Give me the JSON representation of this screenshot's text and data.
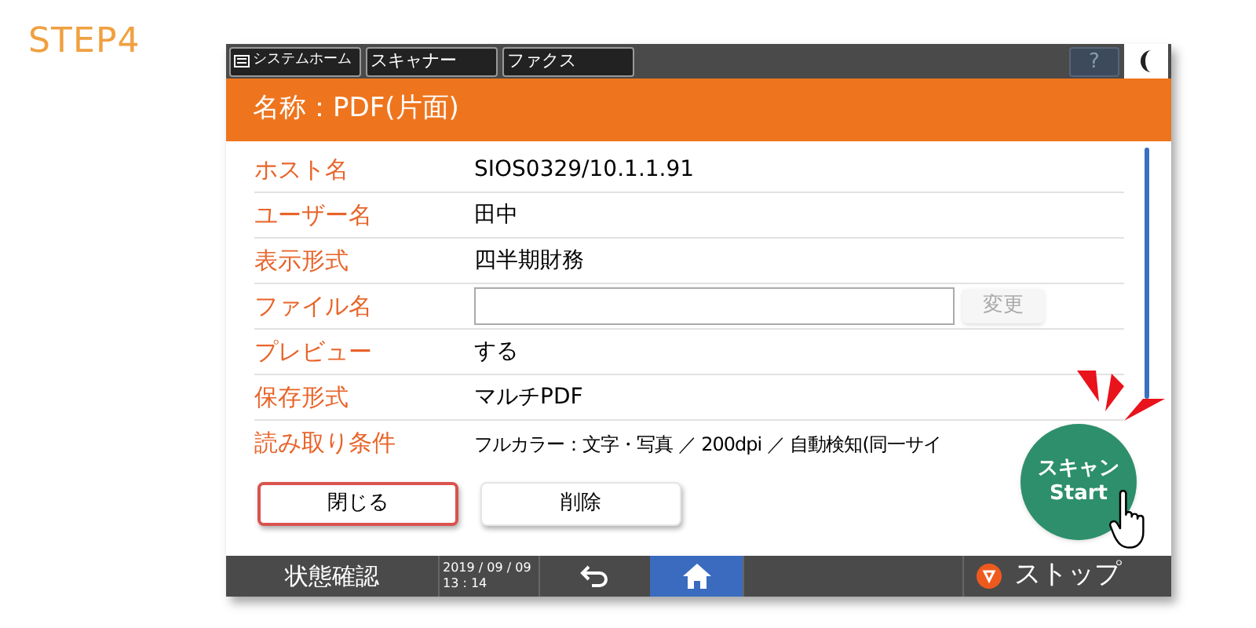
{
  "step_label": "STEP4",
  "top_tabs": [
    {
      "label": "システムホーム",
      "kind": "home"
    },
    {
      "label": "スキャナー",
      "kind": "plain"
    },
    {
      "label": "ファクス",
      "kind": "plain"
    }
  ],
  "help_button": "?",
  "title": "名称：PDF(片面)",
  "fields": [
    {
      "label": "ホスト名",
      "kind": "text",
      "value": "SIOS0329/10.1.1.91"
    },
    {
      "label": "ユーザー名",
      "kind": "text",
      "value": "田中"
    },
    {
      "label": "表示形式",
      "kind": "text",
      "value": "四半期財務"
    },
    {
      "label": "ファイル名",
      "kind": "input",
      "button": "変更",
      "disabled": true
    },
    {
      "label": "プレビュー",
      "kind": "text",
      "value": "する"
    },
    {
      "label": "保存形式",
      "kind": "text",
      "value": "マルチPDF"
    },
    {
      "label": "読み取り条件",
      "kind": "text",
      "value": "フルカラー：文字・写真 ／ 200dpi ／ 自動検知(同一サイ"
    }
  ],
  "buttons": [
    {
      "label": "閉じる",
      "highlighted": true
    },
    {
      "label": "削除",
      "highlighted": false
    }
  ],
  "start_button": {
    "label": "スキャン",
    "sublabel": "Start"
  },
  "status_bar": {
    "status_button": "状態確認",
    "date": "2019 / 09 / 09",
    "time": "13 : 14",
    "stop_button": "ストップ"
  }
}
